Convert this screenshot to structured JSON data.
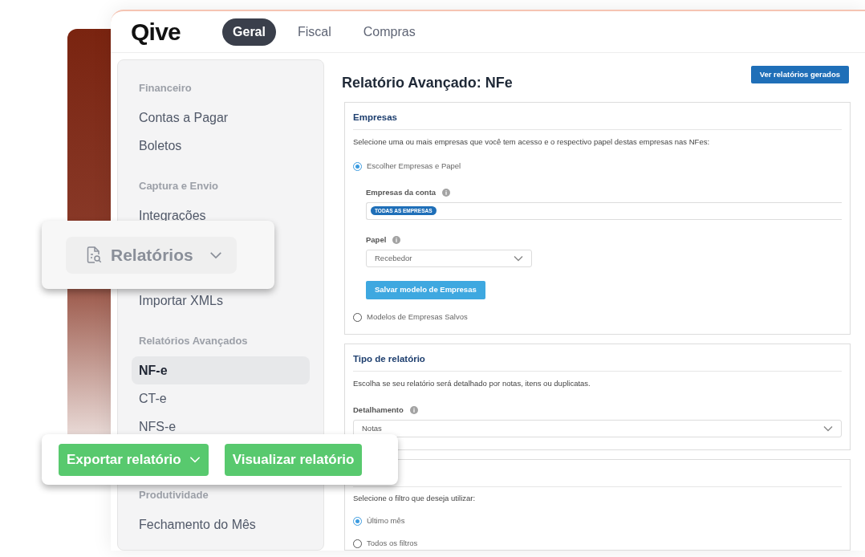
{
  "logo": "Qive",
  "tabs": [
    {
      "label": "Geral",
      "selected": true
    },
    {
      "label": "Fiscal",
      "selected": false
    },
    {
      "label": "Compras",
      "selected": false
    }
  ],
  "sidebar": {
    "sections": [
      {
        "heading": "Financeiro",
        "items": [
          {
            "label": "Contas a Pagar",
            "selected": false
          },
          {
            "label": "Boletos",
            "selected": false
          }
        ]
      },
      {
        "heading": "Captura e Envio",
        "items": [
          {
            "label": "Integrações",
            "selected": false
          },
          {
            "label": "Importar XMLs",
            "selected": false
          }
        ]
      },
      {
        "heading": "Relatórios Avançados",
        "items": [
          {
            "label": "NF-e",
            "selected": true
          },
          {
            "label": "CT-e",
            "selected": false
          },
          {
            "label": "NFS-e",
            "selected": false
          }
        ]
      },
      {
        "heading": "Produtividade",
        "items": [
          {
            "label": "Fechamento do Mês",
            "selected": false
          }
        ]
      }
    ]
  },
  "page": {
    "title": "Relatório Avançado: NFe",
    "action_button": "Ver relatórios gerados"
  },
  "empresas": {
    "heading": "Empresas",
    "description": "Selecione uma ou mais empresas que você tem acesso e o respectivo papel destas empresas nas NFes:",
    "options": [
      {
        "label": "Escolher Empresas e Papel",
        "selected": true
      },
      {
        "label": "Modelos de Empresas Salvos",
        "selected": false
      }
    ],
    "accounts_label": "Empresas da conta",
    "tags": [
      "TODAS AS EMPRESAS"
    ],
    "role_label": "Papel",
    "role_value": "Recebedor",
    "save_button": "Salvar modelo de Empresas"
  },
  "tipo": {
    "heading": "Tipo de relatório",
    "description": "Escolha se seu relatório será detalhado por notas, itens ou duplicatas.",
    "field_label": "Detalhamento",
    "field_value": "Notas"
  },
  "filtros": {
    "description": "Selecione o filtro que deseja utilizar:",
    "options": [
      {
        "label": "Último mês",
        "selected": true
      },
      {
        "label": "Todos os filtros",
        "selected": false
      }
    ]
  },
  "reports_menu": {
    "label": "Relatórios"
  },
  "actions": {
    "export_button": "Exportar relatório",
    "view_button": "Visualizar relatório"
  }
}
